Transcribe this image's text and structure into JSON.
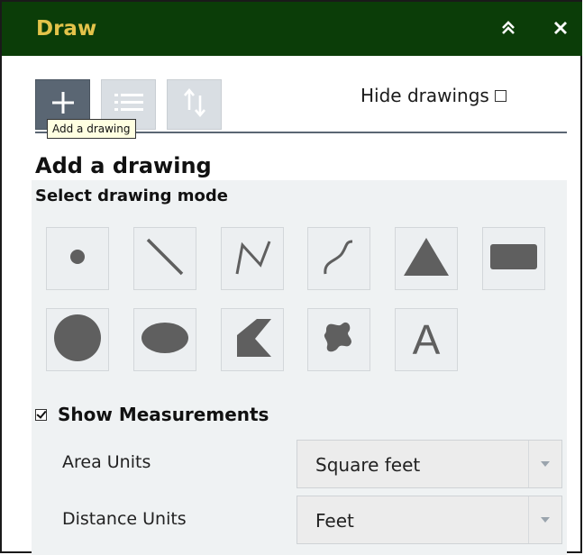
{
  "panel": {
    "title": "Draw",
    "collapse_icon": "double-chevron-up-icon",
    "close_icon": "close-icon",
    "title_color": "#e3c34a",
    "titlebar_color": "#0b3d08"
  },
  "tabs": [
    {
      "name": "add",
      "icon": "plus-icon",
      "active": true
    },
    {
      "name": "list",
      "icon": "list-icon",
      "active": false
    },
    {
      "name": "sort",
      "icon": "sort-arrows-icon",
      "active": false
    }
  ],
  "tooltip": "Add a drawing",
  "hide_drawings": {
    "label": "Hide drawings",
    "checked": false
  },
  "section_title": "Add a drawing",
  "mode_title": "Select drawing mode",
  "modes_row1": [
    "point-icon",
    "line-icon",
    "polyline-icon",
    "freehand-line-icon",
    "triangle-icon",
    "rectangle-icon"
  ],
  "modes_row2": [
    "circle-icon",
    "ellipse-icon",
    "polygon-icon",
    "freehand-polygon-icon",
    "text-icon"
  ],
  "text_mode_glyph": "A",
  "show_measurements": {
    "label": "Show Measurements",
    "checked": true
  },
  "area_units": {
    "label": "Area Units",
    "value": "Square feet"
  },
  "distance_units": {
    "label": "Distance Units",
    "value": "Feet"
  }
}
